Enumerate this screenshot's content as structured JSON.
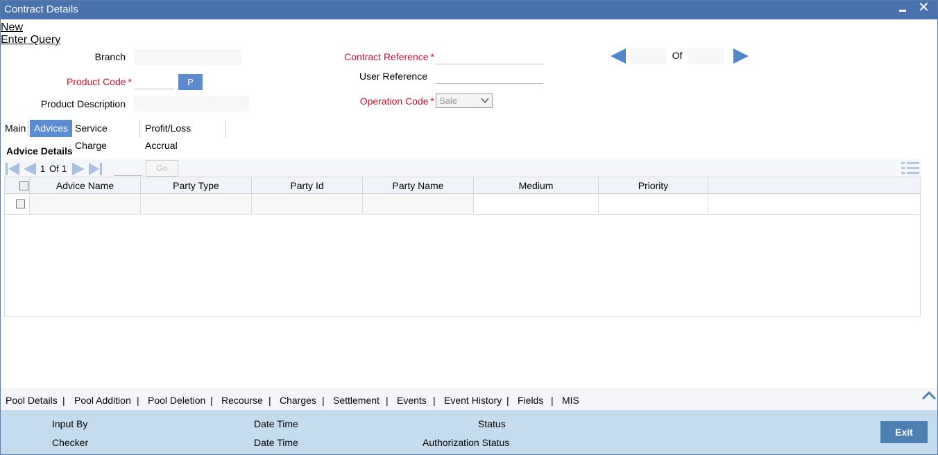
{
  "window": {
    "title": "Contract Details"
  },
  "menu": {
    "new": "New",
    "enter_query": "Enter Query"
  },
  "form": {
    "branch_label": "Branch",
    "product_code_label": "Product Code",
    "product_desc_label": "Product Description",
    "contract_ref_label": "Contract Reference",
    "user_ref_label": "User Reference",
    "operation_code_label": "Operation Code",
    "operation_code_value": "Sale",
    "p_button": "P",
    "of_label": "Of",
    "required_mark": "*"
  },
  "tabs": [
    "Main",
    "Advices",
    "Service Charge",
    "Profit/Loss Accrual"
  ],
  "advice": {
    "section_title": "Advice Details",
    "pager": {
      "current": "1",
      "of": "Of",
      "total": "1",
      "go": "Go"
    },
    "columns": [
      "Advice Name",
      "Party Type",
      "Party Id",
      "Party Name",
      "Medium",
      "Priority"
    ]
  },
  "bottom_links": [
    "Pool Details",
    "Pool Addition",
    "Pool Deletion",
    "Recourse",
    "Charges",
    "Settlement",
    "Events",
    "Event History",
    "Fields",
    "MIS"
  ],
  "footer": {
    "input_by": "Input By",
    "checker": "Checker",
    "date_time_1": "Date Time",
    "date_time_2": "Date Time",
    "status": "Status",
    "auth_status": "Authorization Status",
    "exit": "Exit"
  },
  "colors": {
    "titlebar": "#4a73ad",
    "accent": "#5b8bd0",
    "required": "#c8102e",
    "footer": "#c5dcef"
  }
}
